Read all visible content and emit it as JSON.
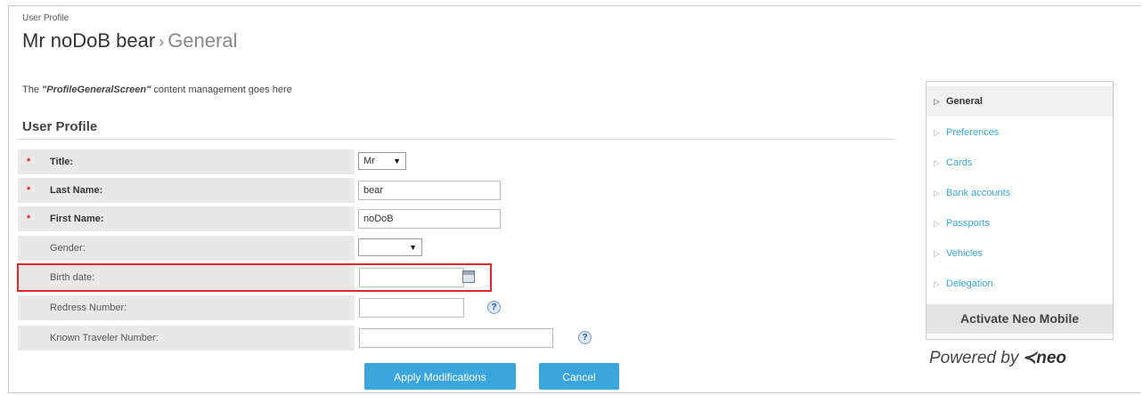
{
  "header": {
    "breadcrumb": "User Profile",
    "title_main": "Mr noDoB bear",
    "title_sep": "›",
    "title_sub": "General"
  },
  "cms_note": {
    "prefix": "The ",
    "screen_name": "\"ProfileGeneralScreen\"",
    "suffix": " content management goes here"
  },
  "form": {
    "section_title": "User Profile",
    "required_mark": "*",
    "fields": {
      "title": {
        "label": "Title:",
        "value": "Mr",
        "arrow": "▼"
      },
      "last_name": {
        "label": "Last Name:",
        "value": "bear"
      },
      "first_name": {
        "label": "First Name:",
        "value": "noDoB"
      },
      "gender": {
        "label": "Gender:",
        "value": "",
        "arrow": "▼"
      },
      "birth_date": {
        "label": "Birth date:",
        "value": "",
        "icon": "calendar-icon"
      },
      "redress_number": {
        "label": "Redress Number:",
        "value": "",
        "help": "?"
      },
      "known_traveler_number": {
        "label": "Known Traveler Number:",
        "value": "",
        "help": "?"
      }
    },
    "highlight_color": "#e0282c"
  },
  "actions": {
    "apply": "Apply Modifications",
    "cancel": "Cancel",
    "button_color": "#3aa6dd"
  },
  "sidebar": {
    "tri": "▷",
    "items": [
      {
        "label": "General",
        "active": true
      },
      {
        "label": "Preferences"
      },
      {
        "label": "Cards"
      },
      {
        "label": "Bank accounts"
      },
      {
        "label": "Passports"
      },
      {
        "label": "Vehicles"
      },
      {
        "label": "Delegation"
      }
    ],
    "activate": "Activate Neo Mobile",
    "powered_by": "Powered by",
    "logo_text": "≺neo"
  }
}
